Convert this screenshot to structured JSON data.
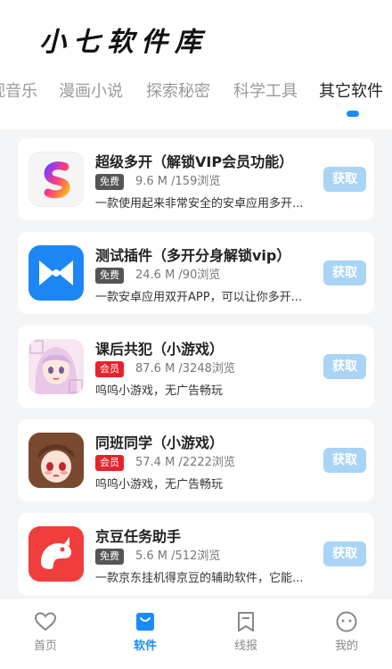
{
  "header": {
    "title": "小七软件库"
  },
  "tabs": [
    {
      "label": "视音乐"
    },
    {
      "label": "漫画小说"
    },
    {
      "label": "探索秘密"
    },
    {
      "label": "科学工具"
    },
    {
      "label": "其它软件"
    }
  ],
  "apps": [
    {
      "title": "超级多开（解锁VIP会员功能）",
      "badge": "免费",
      "meta": "9.6 M /159浏览",
      "desc": "一款使用起来非常安全的安卓应用多开...",
      "action": "获取",
      "icon": "s-logo-icon"
    },
    {
      "title": "测试插件（多开分身解锁vip）",
      "badge": "免费",
      "meta": "24.6 M /90浏览",
      "desc": "一款安卓应用双开APP，可以让你多开...",
      "action": "获取",
      "icon": "bowtie-icon"
    },
    {
      "title": "课后共犯（小游戏）",
      "badge": "会员",
      "meta": "87.6 M /3248浏览",
      "desc": "呜呜小游戏，无广告畅玩",
      "action": "获取",
      "icon": "anime-girl-icon"
    },
    {
      "title": "同班同学（小游戏）",
      "badge": "会员",
      "meta": "57.4 M /2222浏览",
      "desc": "呜呜小游戏，无广告畅玩",
      "action": "获取",
      "icon": "anime-girl-icon"
    },
    {
      "title": "京豆任务助手",
      "badge": "免费",
      "meta": "5.6 M /512浏览",
      "desc": "一款京东挂机得京豆的辅助软件，它能...",
      "action": "获取",
      "icon": "jd-dog-icon"
    }
  ],
  "nav": [
    {
      "label": "首页",
      "icon": "heart-icon"
    },
    {
      "label": "软件",
      "icon": "bag-icon"
    },
    {
      "label": "线报",
      "icon": "bookmark-icon"
    },
    {
      "label": "我的",
      "icon": "face-icon"
    }
  ],
  "colors": {
    "accent": "#1a8cff",
    "member_badge": "#e8222b",
    "free_badge": "#555555",
    "get_button": "#a9d4f5"
  }
}
